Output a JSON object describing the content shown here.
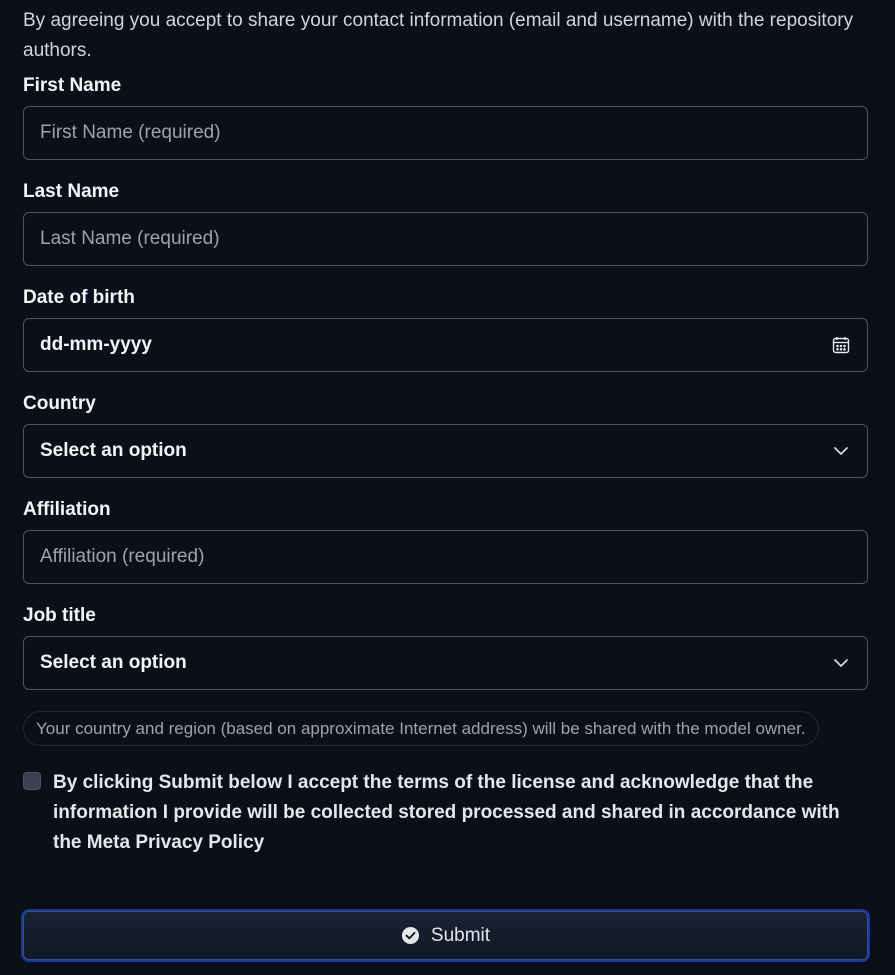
{
  "intro": "By agreeing you accept to share your contact information (email and username) with the repository authors.",
  "fields": {
    "first_name": {
      "label": "First Name",
      "placeholder": "First Name (required)"
    },
    "last_name": {
      "label": "Last Name",
      "placeholder": "Last Name (required)"
    },
    "dob": {
      "label": "Date of birth",
      "value": "dd-mm-yyyy",
      "icon": "calendar-icon"
    },
    "country": {
      "label": "Country",
      "value": "Select an option",
      "icon": "chevron-down-icon"
    },
    "affiliation": {
      "label": "Affiliation",
      "placeholder": "Affiliation (required)"
    },
    "job_title": {
      "label": "Job title",
      "value": "Select an option",
      "icon": "chevron-down-icon"
    }
  },
  "notice": "Your country and region (based on approximate Internet address) will be shared with the model owner.",
  "consent": {
    "checked": false,
    "text": "By clicking Submit below I accept the terms of the license and acknowledge that the information I provide will be collected stored processed and shared in accordance with the Meta Privacy Policy"
  },
  "submit": {
    "label": "Submit",
    "icon": "check-circle-icon"
  },
  "colors": {
    "background": "#0b0f19",
    "border": "#4b5563",
    "button_border": "#1e3a8a"
  }
}
